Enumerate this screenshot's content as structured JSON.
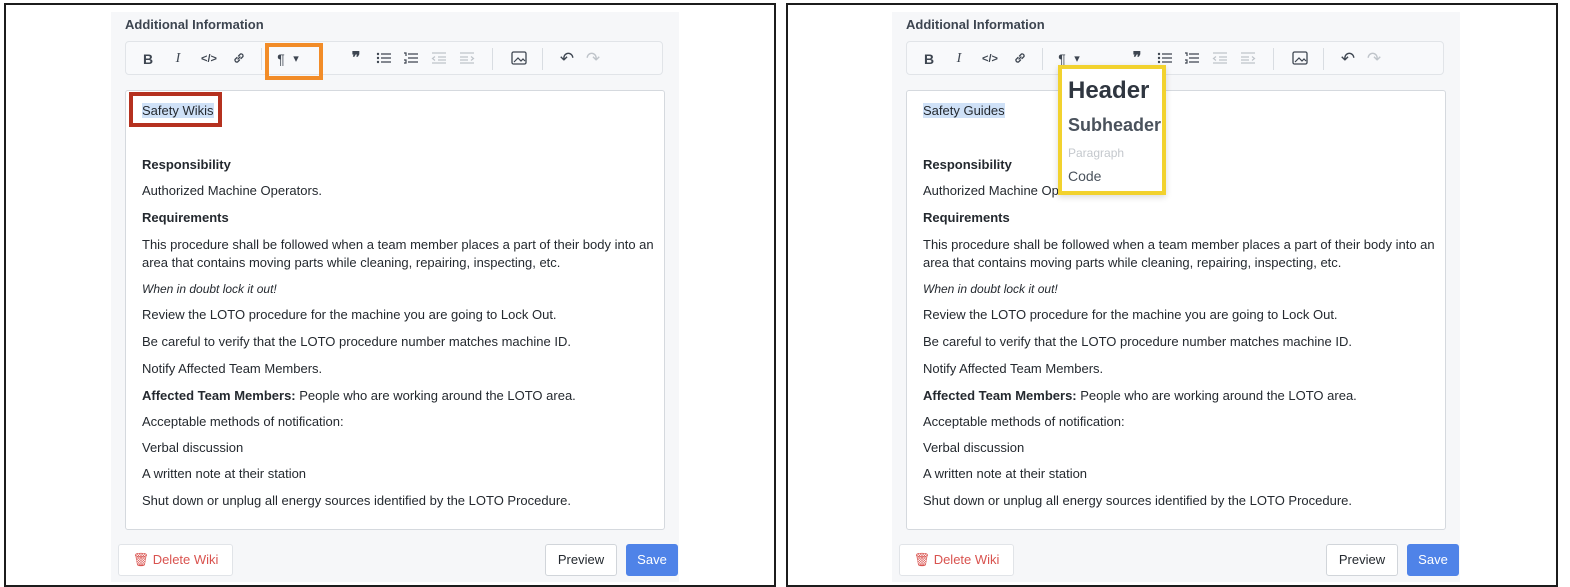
{
  "section_title": "Additional Information",
  "toolbar": {
    "bold": "B",
    "italic": "I",
    "code": "</>",
    "link_icon": "link-icon",
    "paragraph": "¶",
    "dropdown_caret": "▾",
    "quote": "❞",
    "image_icon": "image-icon",
    "undo": "↶",
    "redo": "↷"
  },
  "left": {
    "title_text": "Safety Wikis"
  },
  "right": {
    "title_text": "Safety Guides",
    "dropdown": {
      "header": "Header",
      "subheader": "Subheader",
      "paragraph": "Paragraph",
      "code": "Code"
    }
  },
  "content": {
    "responsibility_heading": "Responsibility",
    "responsibility_text": "Authorized Machine Operators.",
    "requirements_heading": "Requirements",
    "requirements_text_1": "This procedure shall be followed when a team member places a part of their body into an",
    "requirements_text_2": "area that contains moving parts while cleaning, repairing, inspecting, etc.",
    "doubt_text": "When in doubt lock it out!",
    "review_text": "Review the LOTO procedure for the machine you are going to Lock Out.",
    "verify_text": "Be careful to verify that the LOTO procedure number matches machine ID.",
    "notify_text": "Notify Affected Team Members.",
    "affected_label": "Affected Team Members:",
    "affected_text": " People who are working around the LOTO area.",
    "methods_text": "Acceptable methods of notification:",
    "verbal_text": "Verbal discussion",
    "written_text": "A written note at their station",
    "shutdown_text": "Shut down or unplug all energy sources identified by the LOTO Procedure."
  },
  "footer": {
    "delete_label": "Delete Wiki",
    "preview_label": "Preview",
    "save_label": "Save"
  },
  "colors": {
    "highlight_orange": "#f28c28",
    "highlight_red": "#b5311f",
    "highlight_yellow": "#f2d22e",
    "save_blue": "#4f83e8",
    "delete_red": "#d9534f"
  }
}
